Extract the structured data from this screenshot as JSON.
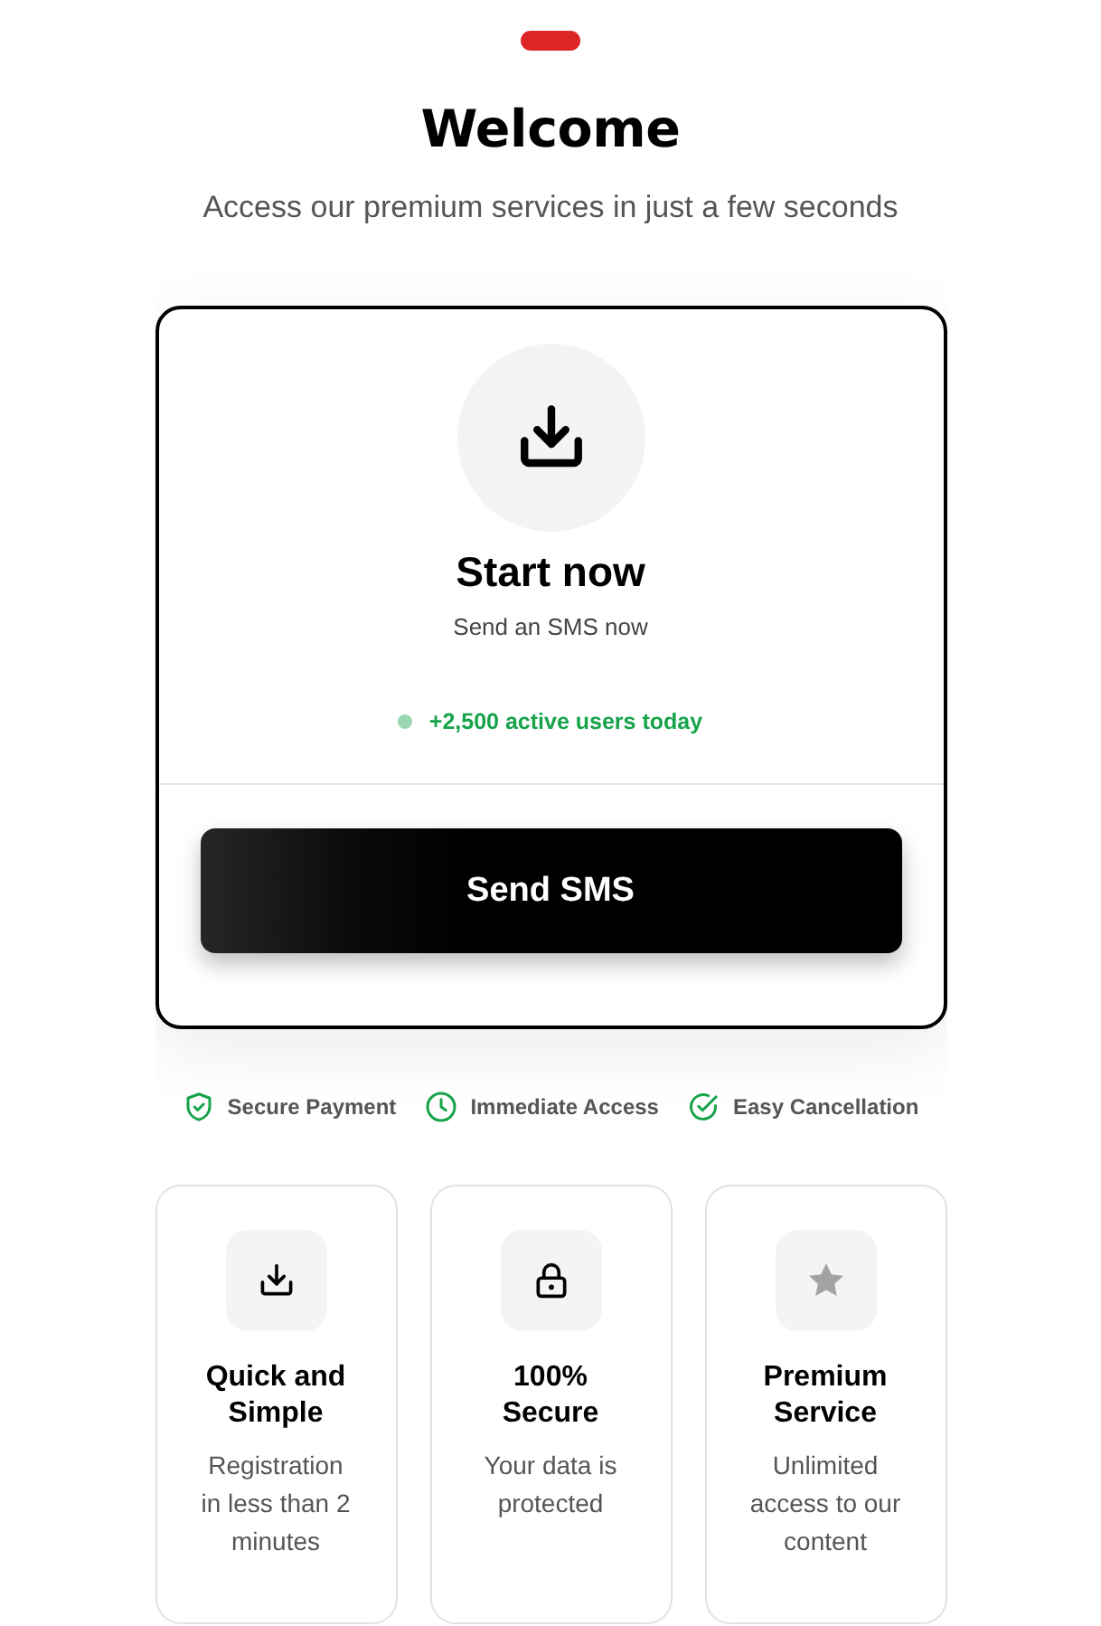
{
  "header": {
    "title": "Welcome",
    "subtitle": "Access our premium services in just a few seconds"
  },
  "card": {
    "title": "Start now",
    "subtitle": "Send an SMS now",
    "active_users": "+2,500 active users today",
    "button": "Send SMS"
  },
  "trust_badges": [
    "Secure Payment",
    "Immediate Access",
    "Easy Cancellation"
  ],
  "features": [
    {
      "title": "Quick and Simple",
      "description": "Registration in less than 2 minutes"
    },
    {
      "title": "100% Secure",
      "description": "Your data is protected"
    },
    {
      "title": "Premium Service",
      "description": "Unlimited access to our content"
    }
  ]
}
